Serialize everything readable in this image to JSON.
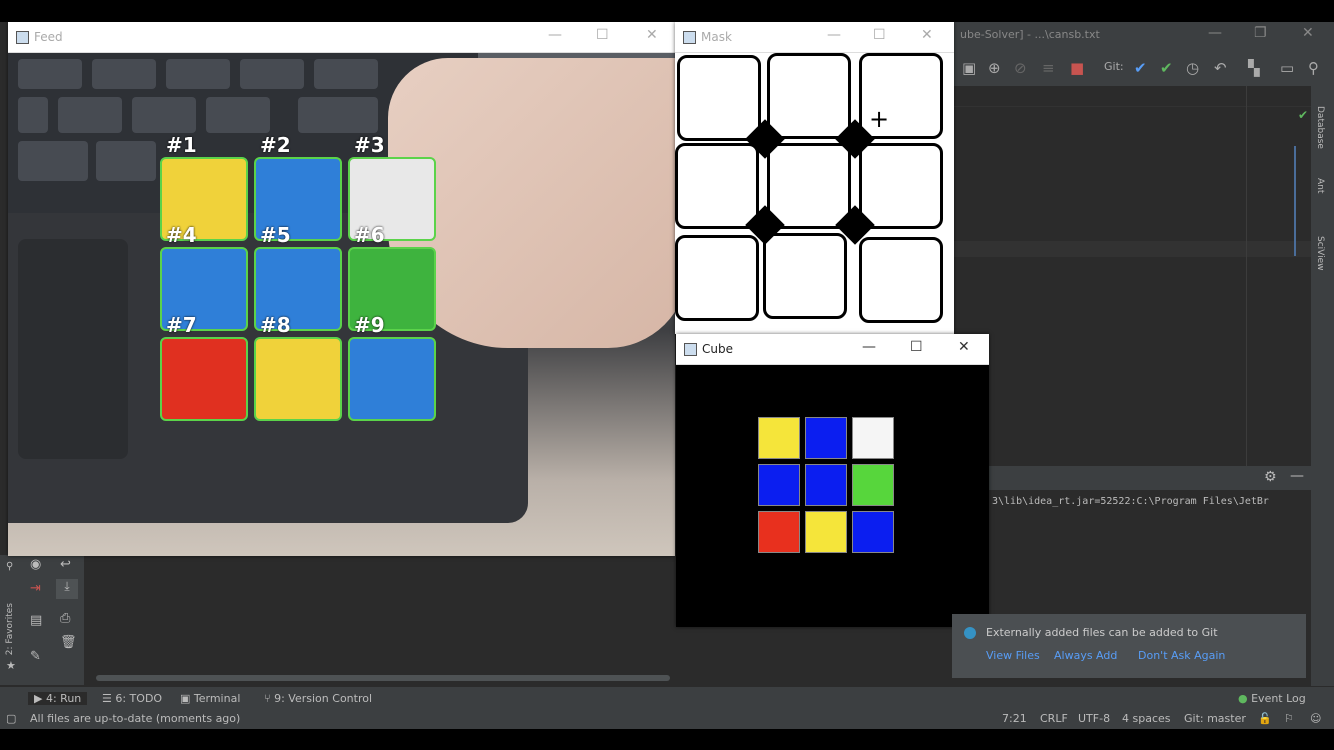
{
  "ide": {
    "window_title": "ube-Solver] - ...\\cansb.txt",
    "git_label": "Git:",
    "console_text": "3\\lib\\idea_rt.jar=52522:C:\\Program Files\\JetBr",
    "right_tabs": [
      "Database",
      "Ant",
      "SciView"
    ],
    "left_tab": "2: Favorites"
  },
  "feed_window": {
    "title": "Feed",
    "labels": [
      "#1",
      "#2",
      "#3",
      "#4",
      "#5",
      "#6",
      "#7",
      "#8",
      "#9"
    ],
    "sticker_colors": [
      "#f0d23a",
      "#2f7fd8",
      "#e8e8e8",
      "#2f7fd8",
      "#2f7fd8",
      "#3eb33e",
      "#e03020",
      "#f0d23a",
      "#2f7fd8"
    ]
  },
  "mask_window": {
    "title": "Mask"
  },
  "cube_window": {
    "title": "Cube",
    "cells": [
      "#f5e53a",
      "#0b1ef0",
      "#f5f5f5",
      "#0b1ef0",
      "#0b1ef0",
      "#57d63c",
      "#e8301e",
      "#f5e53a",
      "#0b1ef0"
    ]
  },
  "notification": {
    "message": "Externally added files can be added to Git",
    "links": [
      "View Files",
      "Always Add",
      "Don't Ask Again"
    ]
  },
  "bottom_tabs": [
    "4: Run",
    "6: TODO",
    "Terminal",
    "9: Version Control",
    "Event Log"
  ],
  "status": {
    "message": "All files are up-to-date (moments ago)",
    "position": "7:21",
    "line_sep": "CRLF",
    "encoding": "UTF-8",
    "indent": "4 spaces",
    "branch": "Git: master"
  }
}
